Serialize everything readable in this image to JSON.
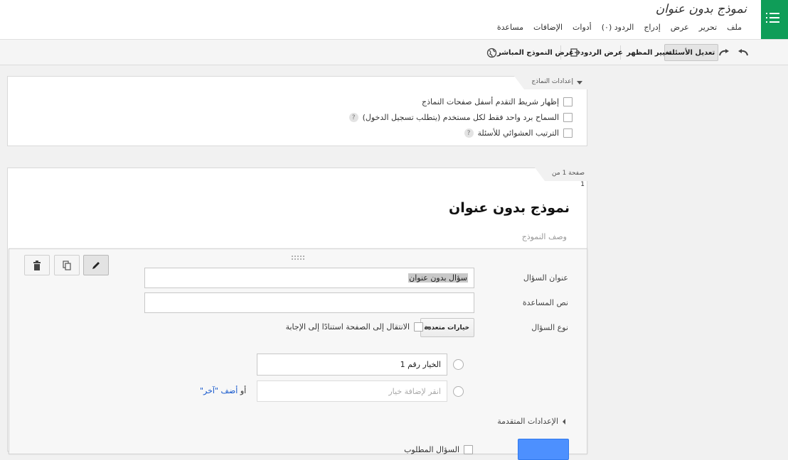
{
  "header": {
    "doc_title": "نموذج بدون عنوان",
    "menu": [
      "ملف",
      "تحرير",
      "عرض",
      "إدراج",
      "الردود (٠)",
      "أدوات",
      "الإضافات",
      "مساعدة"
    ]
  },
  "toolbar": {
    "edit_questions": "تعديل الأسئلة",
    "change_theme": "تغيير المظهر",
    "view_responses": "عرض الردود",
    "view_live_form": "عرض النموذج المباشر"
  },
  "settings": {
    "header": "إعدادات النماذج",
    "options": [
      {
        "label": "إظهار شريط التقدم أسفل صفحات النماذج",
        "checked": false,
        "help": false
      },
      {
        "label": "السماح برد واحد فقط لكل مستخدم (يتطلب تسجيل الدخول)",
        "checked": false,
        "help": true
      },
      {
        "label": "الترتيب العشوائي للأسئلة",
        "checked": false,
        "help": true
      }
    ],
    "help_glyph": "?"
  },
  "page": {
    "header": "صفحة 1 من",
    "number": "1",
    "form_title": "نموذج بدون عنوان",
    "form_description": "وصف النموذج"
  },
  "editor": {
    "question_title_label": "عنوان السؤال",
    "question_title_value": "سؤال بدون عنوان",
    "help_text_label": "نص المساعدة",
    "help_text_value": "",
    "question_type_label": "نوع السؤال",
    "question_type_value": "خيارات متعددة",
    "goto_page_label": "الانتقال إلى الصفحة استنادًا إلى الإجابة",
    "option1_value": "الخيار رقم 1",
    "option2_placeholder": "انقر لإضافة خيار",
    "or_text": "أو ",
    "add_other_link": "أضف \"آخر\"",
    "advanced_settings": "الإعدادات المتقدمة",
    "bottom_label": "السؤال المطلوب"
  },
  "colors": {
    "brand_green": "#0f9d58",
    "primary_blue": "#4d90fe",
    "link_blue": "#1155cc"
  },
  "icons": [
    "menu-icon",
    "undo-icon",
    "redo-icon",
    "export-icon",
    "globe-icon",
    "trash-icon",
    "copy-icon",
    "pencil-icon",
    "chevron-down-icon",
    "chevron-left-icon"
  ]
}
